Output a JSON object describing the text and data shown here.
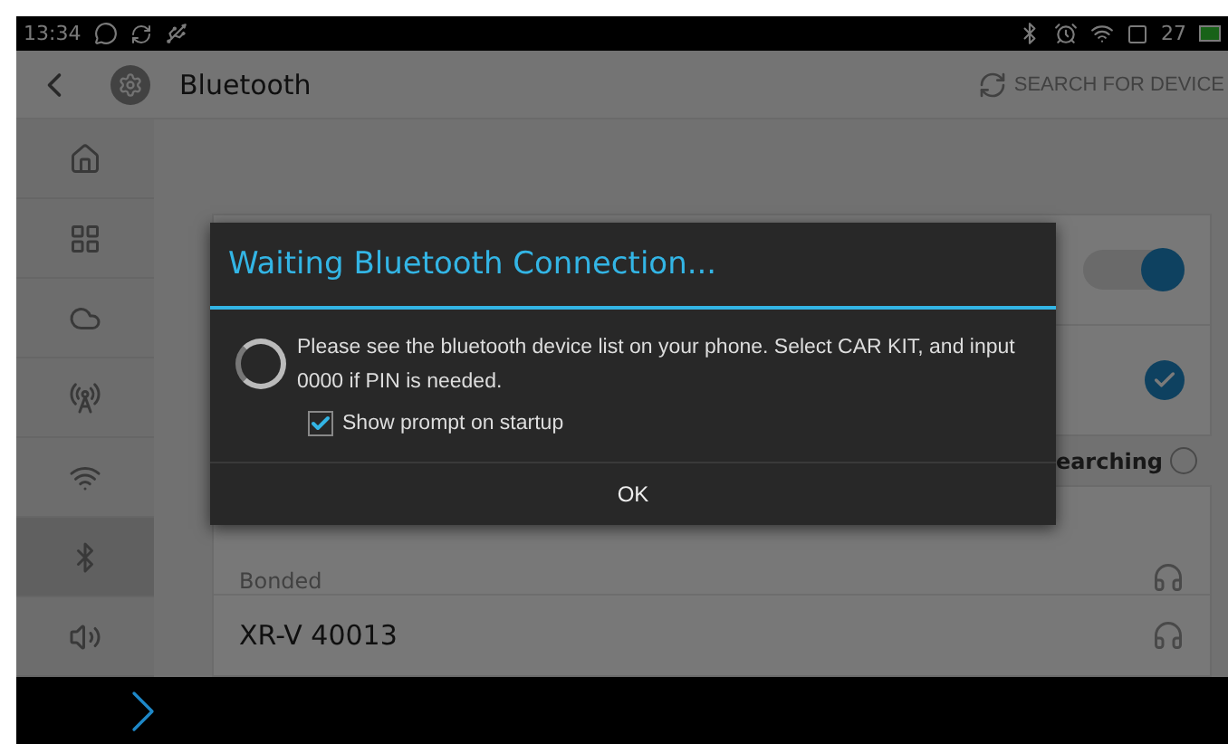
{
  "status_bar": {
    "time": "13:34",
    "battery": "27"
  },
  "app_bar": {
    "title": "Bluetooth",
    "action": "SEARCH FOR DEVICE"
  },
  "sidebar": {
    "items": [
      {
        "kind": "home",
        "selected": false
      },
      {
        "kind": "apps",
        "selected": false
      },
      {
        "kind": "cloud",
        "selected": false
      },
      {
        "kind": "antenna",
        "selected": false
      },
      {
        "kind": "wifi",
        "selected": false
      },
      {
        "kind": "bluetooth",
        "selected": true
      },
      {
        "kind": "volume",
        "selected": false
      }
    ]
  },
  "settings": {
    "toggle_on": true,
    "visible_checked": true,
    "searching_label": "earching"
  },
  "devices": {
    "header": "Bonded",
    "items": [
      "XR-V 40013"
    ]
  },
  "dialog": {
    "title": "Waiting Bluetooth Connection...",
    "message": "Please see the bluetooth device list on your phone. Select CAR KIT, and input 0000 if PIN is needed.",
    "checkbox": {
      "label": "Show prompt on startup",
      "checked": true
    },
    "button": "OK"
  }
}
